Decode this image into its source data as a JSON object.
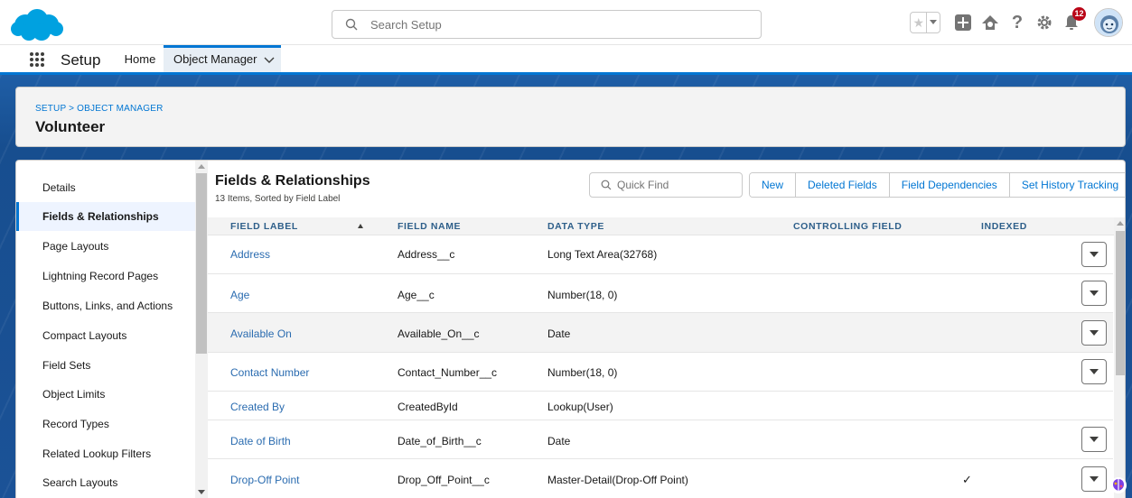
{
  "header": {
    "search_placeholder": "Search Setup",
    "notification_count": "12",
    "icons": [
      "favorites-star-icon",
      "add-icon",
      "trailhead-icon",
      "help-icon",
      "gear-icon",
      "bell-icon"
    ]
  },
  "nav": {
    "app_name": "Setup",
    "tabs": [
      {
        "label": "Home"
      },
      {
        "label": "Object Manager"
      }
    ]
  },
  "page": {
    "breadcrumb": "SETUP > OBJECT MANAGER",
    "title": "Volunteer"
  },
  "sidebar": {
    "items": [
      {
        "label": "Details"
      },
      {
        "label": "Fields & Relationships"
      },
      {
        "label": "Page Layouts"
      },
      {
        "label": "Lightning Record Pages"
      },
      {
        "label": "Buttons, Links, and Actions"
      },
      {
        "label": "Compact Layouts"
      },
      {
        "label": "Field Sets"
      },
      {
        "label": "Object Limits"
      },
      {
        "label": "Record Types"
      },
      {
        "label": "Related Lookup Filters"
      },
      {
        "label": "Search Layouts"
      }
    ],
    "active_index": 1
  },
  "section": {
    "title": "Fields & Relationships",
    "subtitle": "13 Items, Sorted by Field Label",
    "quick_find_placeholder": "Quick Find",
    "buttons": [
      {
        "label": "New"
      },
      {
        "label": "Deleted Fields"
      },
      {
        "label": "Field Dependencies"
      },
      {
        "label": "Set History Tracking"
      }
    ]
  },
  "table": {
    "columns": [
      "FIELD LABEL",
      "FIELD NAME",
      "DATA TYPE",
      "CONTROLLING FIELD",
      "INDEXED"
    ],
    "rows": [
      {
        "label": "Address",
        "name": "Address__c",
        "type": "Long Text Area(32768)",
        "controlling": "",
        "indexed": false,
        "menu": true
      },
      {
        "label": "Age",
        "name": "Age__c",
        "type": "Number(18, 0)",
        "controlling": "",
        "indexed": false,
        "menu": true
      },
      {
        "label": "Available On",
        "name": "Available_On__c",
        "type": "Date",
        "controlling": "",
        "indexed": false,
        "menu": true
      },
      {
        "label": "Contact Number",
        "name": "Contact_Number__c",
        "type": "Number(18, 0)",
        "controlling": "",
        "indexed": false,
        "menu": true
      },
      {
        "label": "Created By",
        "name": "CreatedById",
        "type": "Lookup(User)",
        "controlling": "",
        "indexed": false,
        "menu": false
      },
      {
        "label": "Date of Birth",
        "name": "Date_of_Birth__c",
        "type": "Date",
        "controlling": "",
        "indexed": false,
        "menu": true
      },
      {
        "label": "Drop-Off Point",
        "name": "Drop_Off_Point__c",
        "type": "Master-Detail(Drop-Off Point)",
        "controlling": "",
        "indexed": true,
        "menu": true
      }
    ]
  },
  "colors": {
    "brand": "#0176d3",
    "link": "#2b6cb0",
    "band": "#1b5297",
    "badge": "#ba0517"
  }
}
